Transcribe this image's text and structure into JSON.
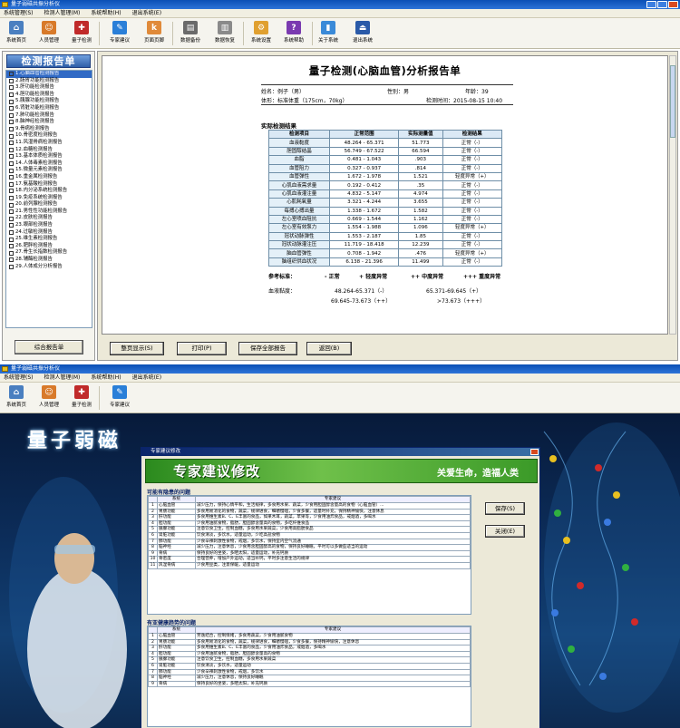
{
  "top": {
    "title": "量子弱磁共振分析仪",
    "menu": [
      "系统管理(S)",
      "检测人管理(M)",
      "系统帮助(H)",
      "退出系统(E)"
    ],
    "toolbar": [
      "系统首页",
      "人员管理",
      "量子检测",
      "专家建议",
      "页面页脚",
      "数据备份",
      "数据恢复",
      "系统设置",
      "系统帮助",
      "关于系统",
      "退出系统"
    ],
    "panel_title": "检测报告单",
    "reports": [
      "1.心脑血管检测报告",
      "2.肠胃功能检测报告",
      "3.肝功能检测报告",
      "4.胆功能检测报告",
      "5.胰腺功能检测报告",
      "6.肾脏功能检测报告",
      "7.肺功能检测报告",
      "8.脑神经检测报告",
      "9.骨病检测报告",
      "10.骨密度检测报告",
      "11.风湿骨病检测报告",
      "12.血糖检测报告",
      "13.基本体质检测报告",
      "14.人体毒素检测报告",
      "15.微量元素检测报告",
      "16.重金属检测报告",
      "17.氨基酸检测报告",
      "18.内分泌系统检测报告",
      "19.免疫系统检测报告",
      "20.前列腺检测报告",
      "21.男性性功能检测报告",
      "22.皮肤检测报告",
      "23.眼部检测报告",
      "24.过敏检测报告",
      "25.维生素检测报告",
      "26.肥胖检测报告",
      "27.骨生长指数检测报告",
      "28.辅酶检测报告",
      "29.人体成分分析报告"
    ],
    "summary_button": "综合报告单",
    "report": {
      "title": "量子检测(心脑血管)分析报告单",
      "name": "姓名：例子（男）",
      "gender": "性别：男",
      "age": "年龄：39",
      "body": "体形：标准体重（175cm，70kg）",
      "time": "检测时间：2015-08-15 10:40",
      "section": "实际检测结果",
      "headers": [
        "检测项目",
        "正常范围",
        "实际测量值",
        "检测结果"
      ],
      "rows": [
        [
          "血液黏度",
          "48.264 - 65.371",
          "51.773",
          "正常（-）"
        ],
        [
          "胆固醇结晶",
          "56.749 - 67.522",
          "66.594",
          "正常（-）"
        ],
        [
          "血脂",
          "0.481 - 1.043",
          ".903",
          "正常（-）"
        ],
        [
          "血管阻力",
          "0.327 - 0.937",
          ".814",
          "正常（-）"
        ],
        [
          "血管弹性",
          "1.672 - 1.978",
          "1.521",
          "轻度异常（+）"
        ],
        [
          "心肌血液需求量",
          "0.192 - 0.412",
          ".35",
          "正常（-）"
        ],
        [
          "心肌血液灌注量",
          "4.832 - 5.147",
          "4.974",
          "正常（-）"
        ],
        [
          "心肌耗氧量",
          "3.321 - 4.244",
          "3.655",
          "正常（-）"
        ],
        [
          "每搏心搏出量",
          "1.338 - 1.672",
          "1.582",
          "正常（-）"
        ],
        [
          "左心室喷血阻抗",
          "0.669 - 1.544",
          "1.162",
          "正常（-）"
        ],
        [
          "左心室有效泵力",
          "1.554 - 1.988",
          "1.096",
          "轻度异常（+）"
        ],
        [
          "冠状动脉弹性",
          "1.553 - 2.187",
          "1.85",
          "正常（-）"
        ],
        [
          "冠状动脉灌注压",
          "11.719 - 18.418",
          "12.239",
          "正常（-）"
        ],
        [
          "脑血管弹性",
          "0.708 - 1.942",
          ".476",
          "轻度异常（+）"
        ],
        [
          "脑组织供血状况",
          "6.138 - 21.396",
          "11.499",
          "正常（-）"
        ]
      ],
      "legend": [
        "参考标准：",
        "-  正常",
        "+  轻度异常",
        "++  中度异常",
        "+++  重度异常"
      ],
      "ref_label": "血液黏度：",
      "ref_values": [
        "48.264-65.371（-）",
        "65.371-69.645（+）",
        "69.645-73.673（++）",
        ">73.673（+++）"
      ]
    },
    "buttons": [
      "整页显示(S)",
      "打印(P)",
      "保存全部报告",
      "返回(B)"
    ]
  },
  "bottom": {
    "title": "量子弱磁共振分析仪",
    "menu": [
      "系统管理(S)",
      "检测人管理(M)",
      "系统帮助(H)",
      "退出系统(E)"
    ],
    "toolbar": [
      "系统首页",
      "人员管理",
      "量子检测",
      "专家建议"
    ],
    "bg_text": "量子弱磁",
    "dialog_title": "专家建议修改",
    "banner_left": "专家建议修改",
    "banner_right": "关爱生命，造福人类",
    "group1": "可能有隐患的问题",
    "group2": "有亚健康趋势的问题",
    "col_system": "系统",
    "col_advice": "专家建议",
    "save_button": "保存(S)",
    "close_button": "关闭(E)",
    "rows1": [
      [
        "1",
        "心脑血管",
        "减少压力，保持心情平和，生活规律，多食用水果、蔬菜，少食用胆固醇含量高的食物（心脑血管）..."
      ],
      [
        "2",
        "胃肠功能",
        "多食用易消化的食物，蔬菜，规律进食，细嚼慢咽，少食多餐，适量时补充，保持精神愉快，注意休息"
      ],
      [
        "3",
        "肝功能",
        "多食用维生素B、C、E丰富的食品，如果木耳，蔬菜，苹果等，少食用油炸食品，戒烟酒，多喝水"
      ],
      [
        "4",
        "胆功能",
        "少食用油腻食物，脂肪，胆固醇含量高的食物，多吃纤维食品"
      ],
      [
        "5",
        "胰腺功能",
        "注意饮食卫生，控制血糖，多食用水果蔬菜，少食用高脂肪食品"
      ],
      [
        "6",
        "肾脏功能",
        "饮食清淡，多饮水，适量运动，少吃高盐食物"
      ],
      [
        "7",
        "肺功能",
        "少食辛辣刺激性食物，戒烟，多饮水，保持室内空气流通"
      ],
      [
        "8",
        "脑神经",
        "减少压力，注意休息，少食用含胆固醇高的食物，保持良好睡眠，平时可以多做些适当的运动"
      ],
      [
        "9",
        "骨病",
        "保持良好的坐姿，多晒太阳，适量运动，补充钙质"
      ],
      [
        "10",
        "骨密度",
        "合理营养，增加户外运动，适当补钙，平时多注意生活的规律"
      ],
      [
        "11",
        "风湿骨病",
        "少食用豆类，注意保暖，适量运动"
      ]
    ],
    "rows2": [
      [
        "1",
        "心脑血管",
        "劳逸结合，控制情绪，多食用蔬菜，少食用油腻食物"
      ],
      [
        "2",
        "胃肠功能",
        "多食用易消化的食物，蔬菜，规律进食，细嚼慢咽，少食多餐，保持精神愉快，注意休息"
      ],
      [
        "3",
        "肝功能",
        "多食用维生素B、C、E丰富的食品，少食用油炸食品，戒烟酒，多喝水"
      ],
      [
        "4",
        "胆功能",
        "少食用油腻食物，脂肪，胆固醇含量高的食物"
      ],
      [
        "5",
        "胰腺功能",
        "注意饮食卫生，控制血糖，多食用水果蔬菜"
      ],
      [
        "6",
        "肾脏功能",
        "饮食清淡，多饮水，适量运动"
      ],
      [
        "7",
        "肺功能",
        "少食辛辣刺激性食物，戒烟，多饮水"
      ],
      [
        "8",
        "脑神经",
        "减少压力，注意休息，保持良好睡眠"
      ],
      [
        "9",
        "骨病",
        "保持良好的坐姿，多晒太阳，补充钙质"
      ]
    ]
  }
}
